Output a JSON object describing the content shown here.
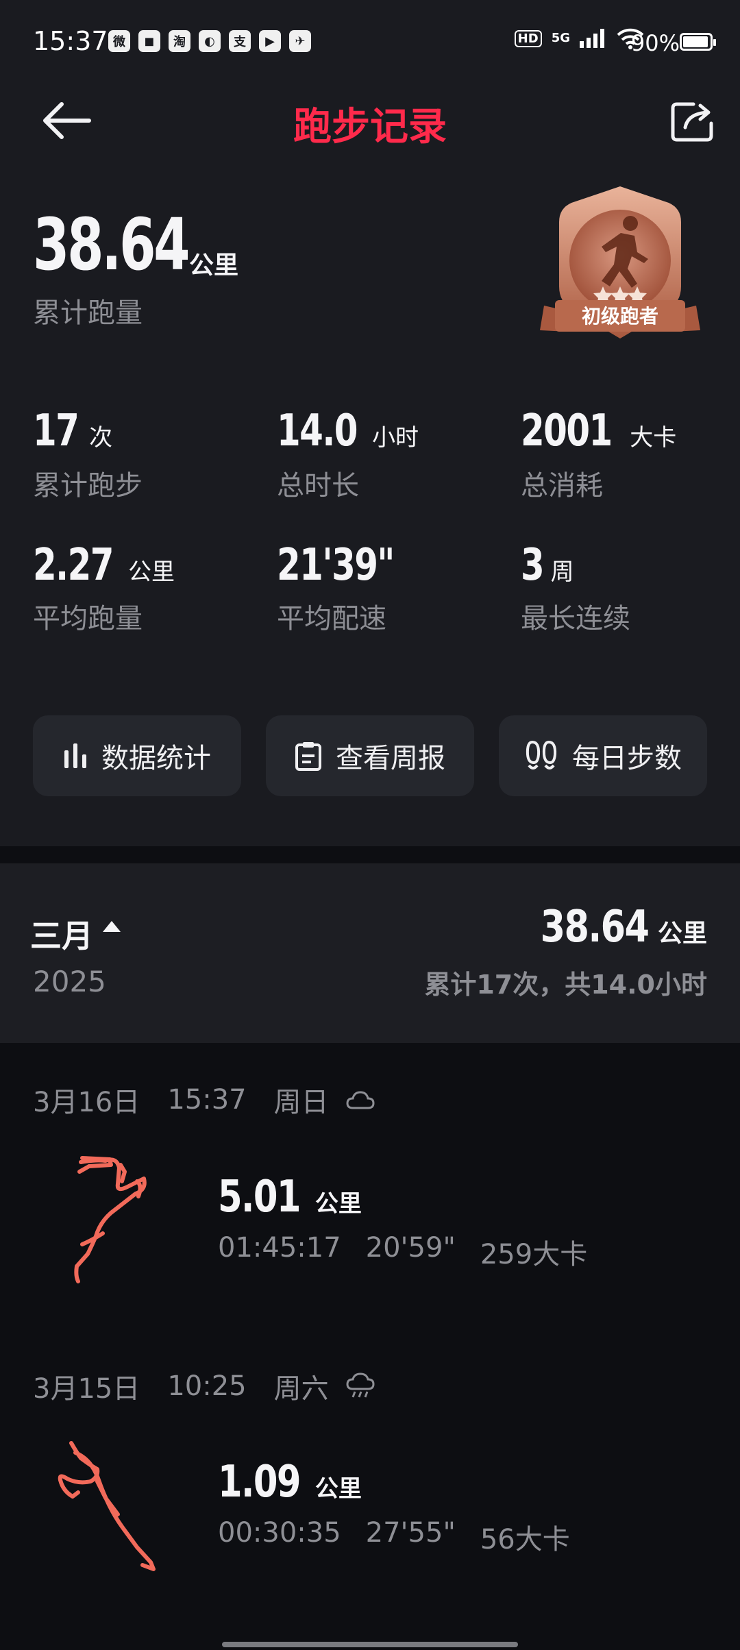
{
  "status_bar": {
    "time": "15:37",
    "apps": [
      "微",
      "◼",
      "淘",
      "◐",
      "支",
      "▶",
      "✈"
    ],
    "hd": "HD",
    "network": "5G",
    "battery": "90%"
  },
  "header": {
    "title": "跑步记录"
  },
  "summary": {
    "total_distance": "38.64",
    "total_unit": "公里",
    "total_label": "累计跑量",
    "badge_text": "初级跑者"
  },
  "stats": [
    {
      "value": "17",
      "unit": "次",
      "label": "累计跑步"
    },
    {
      "value": "14.0",
      "unit": "小时",
      "label": "总时长"
    },
    {
      "value": "2001",
      "unit": "大卡",
      "label": "总消耗"
    },
    {
      "value": "2.27",
      "unit": "公里",
      "label": "平均跑量"
    },
    {
      "value": "21'39\"",
      "unit": "",
      "label": "平均配速"
    },
    {
      "value": "3",
      "unit": "周",
      "label": "最长连续"
    }
  ],
  "actions": [
    {
      "label": "数据统计",
      "icon": "bar-chart-icon"
    },
    {
      "label": "查看周报",
      "icon": "clipboard-icon"
    },
    {
      "label": "每日步数",
      "icon": "footprints-icon"
    }
  ],
  "month": {
    "label": "三月",
    "year": "2025",
    "distance": "38.64",
    "unit": "公里",
    "summary": "累计17次，共14.0小时"
  },
  "records": [
    {
      "date": "3月16日",
      "time": "15:37",
      "weekday": "周日",
      "weather_icon": "cloud-icon",
      "distance": "5.01",
      "unit": "公里",
      "duration": "01:45:17",
      "pace": "20'59\"",
      "calories": "259大卡"
    },
    {
      "date": "3月15日",
      "time": "10:25",
      "weekday": "周六",
      "weather_icon": "rain-icon",
      "distance": "1.09",
      "unit": "公里",
      "duration": "00:30:35",
      "pace": "27'55\"",
      "calories": "56大卡"
    }
  ],
  "colors": {
    "accent": "#ff2a4b",
    "route": "#f26a5a",
    "background": "#1a1b20",
    "card": "#25272d",
    "muted_text": "#8e8f95"
  }
}
